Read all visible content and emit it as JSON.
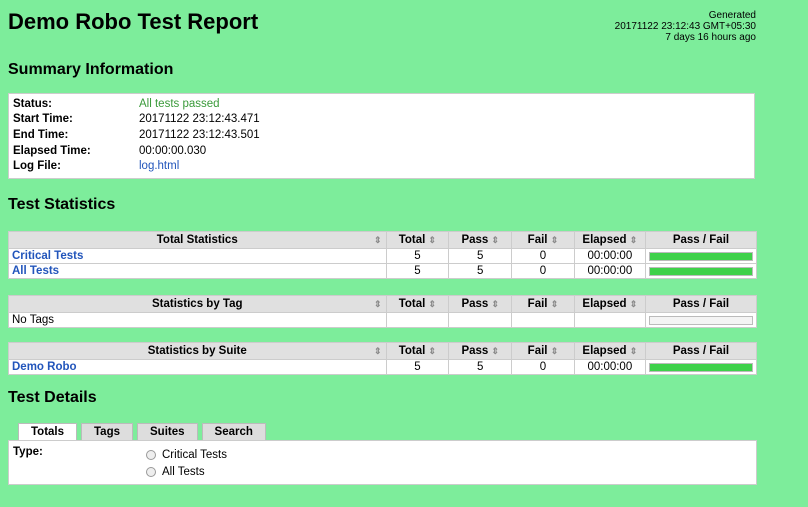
{
  "header": {
    "title": "Demo Robo Test Report",
    "generated_label": "Generated",
    "generated_time": "20171122 23:12:43 GMT+05:30",
    "generated_ago": "7 days 16 hours ago"
  },
  "sections": {
    "summary": "Summary Information",
    "statistics": "Test Statistics",
    "details": "Test Details"
  },
  "summary": {
    "status_label": "Status:",
    "status_value": "All tests passed",
    "start_label": "Start Time:",
    "start_value": "20171122 23:12:43.471",
    "end_label": "End Time:",
    "end_value": "20171122 23:12:43.501",
    "elapsed_label": "Elapsed Time:",
    "elapsed_value": "00:00:00.030",
    "log_label": "Log File:",
    "log_value": "log.html"
  },
  "columns": {
    "total": "Total",
    "pass": "Pass",
    "fail": "Fail",
    "elapsed": "Elapsed",
    "passfail": "Pass / Fail",
    "sort_icon": "⇕"
  },
  "total_stats": {
    "header": "Total Statistics",
    "rows": [
      {
        "name": "Critical Tests",
        "total": "5",
        "pass": "5",
        "fail": "0",
        "elapsed": "00:00:00",
        "pass_fraction": 1.0
      },
      {
        "name": "All Tests",
        "total": "5",
        "pass": "5",
        "fail": "0",
        "elapsed": "00:00:00",
        "pass_fraction": 1.0
      }
    ]
  },
  "tag_stats": {
    "header": "Statistics by Tag",
    "rows": [
      {
        "name": "No Tags",
        "pass_fraction": 0
      }
    ]
  },
  "suite_stats": {
    "header": "Statistics by Suite",
    "rows": [
      {
        "name": "Demo Robo",
        "total": "5",
        "pass": "5",
        "fail": "0",
        "elapsed": "00:00:00",
        "pass_fraction": 1.0
      }
    ]
  },
  "details": {
    "tabs": [
      "Totals",
      "Tags",
      "Suites",
      "Search"
    ],
    "type_label": "Type:",
    "options": [
      "Critical Tests",
      "All Tests"
    ]
  },
  "colors": {
    "background": "#7ded9b",
    "pass_bar": "#3ed14a",
    "link": "#2255bb",
    "pass_text": "#3a9a3a"
  }
}
